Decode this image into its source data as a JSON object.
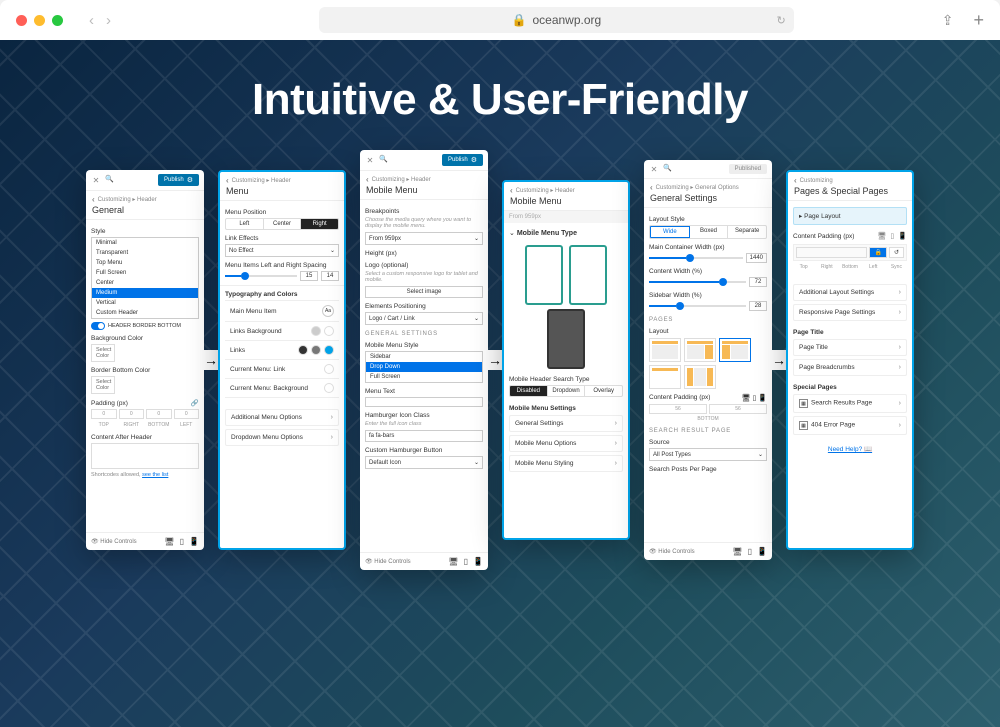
{
  "browser": {
    "url": "oceanwp.org"
  },
  "headline": "Intuitive & User-Friendly",
  "publish": "Publish",
  "published": "Published",
  "panel1": {
    "crumb": "Customizing ▸ Header",
    "title": "General",
    "style_label": "Style",
    "style_options": [
      "Minimal",
      "Transparent",
      "Top Menu",
      "Full Screen",
      "Center",
      "Medium",
      "Vertical",
      "Custom Header"
    ],
    "header_border_label": "HEADER BORDER BOTTOM",
    "bg_color_label": "Background Color",
    "select_color": "Select Color",
    "border_bottom_label": "Border Bottom Color",
    "padding_label": "Padding (px)",
    "padding_sides": [
      "TOP",
      "RIGHT",
      "BOTTOM",
      "LEFT"
    ],
    "padding_vals": [
      "0",
      "0",
      "0",
      "0"
    ],
    "content_after": "Content After Header",
    "shortcodes": "Shortcodes allowed,",
    "shortcodes_link": "see the list",
    "hide_controls": "Hide Controls"
  },
  "panel2": {
    "crumb": "Customizing ▸ Header",
    "title": "Menu",
    "menu_position": "Menu Position",
    "pos_opts": [
      "Left",
      "Center",
      "Right"
    ],
    "link_effects": "Link Effects",
    "no_effect": "No Effect",
    "spacing_label": "Menu Items Left and Right Spacing",
    "spacing_vals": [
      "15",
      "14"
    ],
    "typo_section": "Typography and Colors",
    "main_item": "Main Menu Item",
    "links_bg": "Links Background",
    "links": "Links",
    "current_link": "Current Menu: Link",
    "current_bg": "Current Menu: Background",
    "addl_menu": "Additional Menu Options",
    "dropdown_menu": "Dropdown Menu Options"
  },
  "panel3": {
    "crumb": "Customizing ▸ Header",
    "title": "Mobile Menu",
    "breakpoints_label": "Breakpoints",
    "breakpoints_hint": "Choose the media query where you want to display the mobile menu.",
    "breakpoint_val": "From 959px",
    "height_label": "Height (px)",
    "logo_label": "Logo (optional)",
    "logo_hint": "Select a custom responsive logo for tablet and mobile.",
    "select_image": "Select image",
    "elements_pos": "Elements Positioning",
    "elements_val": "Logo / Cart / Link",
    "general_section": "GENERAL SETTINGS",
    "mobile_style": "Mobile Menu Style",
    "style_opts": [
      "Sidebar",
      "Drop Down",
      "Full Screen"
    ],
    "menu_text": "Menu Text",
    "hamburger_label": "Hamburger Icon Class",
    "hamburger_hint": "Enter the full icon class",
    "hamburger_val": "fa fa-bars",
    "custom_btn": "Custom Hamburger Button",
    "custom_btn_val": "Default Icon",
    "hide_controls": "Hide Controls"
  },
  "panel4": {
    "crumb": "Customizing ▸ Header",
    "title": "Mobile Menu",
    "dd_label": "Mobile Menu Type",
    "search_type": "Mobile Header Search Type",
    "search_opts": [
      "Disabled",
      "Dropdown",
      "Overlay"
    ],
    "settings_section": "Mobile Menu Settings",
    "rows": [
      "General Settings",
      "Mobile Menu Options",
      "Mobile Menu Styling"
    ]
  },
  "panel5": {
    "crumb": "Customizing ▸ General Options",
    "title": "General Settings",
    "layout_style": "Layout Style",
    "layout_opts": [
      "Wide",
      "Boxed",
      "Separate"
    ],
    "main_width": "Main Container Width (px)",
    "main_width_val": "1440",
    "content_width": "Content Width (%)",
    "content_width_val": "72",
    "sidebar_width": "Sidebar Width (%)",
    "sidebar_width_val": "28",
    "pages_section": "PAGES",
    "layout_label": "Layout",
    "content_padding": "Content Padding (px)",
    "cp_vals": [
      "56",
      "56"
    ],
    "bottom_label": "BOTTOM",
    "search_section": "SEARCH RESULT PAGE",
    "source_label": "Source",
    "source_val": "All Post Types",
    "posts_per_page": "Search Posts Per Page",
    "hide_controls": "Hide Controls"
  },
  "panel6": {
    "crumb": "Customizing",
    "title": "Pages & Special Pages",
    "page_layout": "Page Layout",
    "content_padding": "Content Padding (px)",
    "pad_sides": [
      "Top",
      "Right",
      "Bottom",
      "Left",
      "Sync"
    ],
    "rows1": [
      "Additional Layout Settings",
      "Responsive Page Settings"
    ],
    "page_title_section": "Page Title",
    "rows2": [
      "Page Title",
      "Page Breadcrumbs"
    ],
    "special_section": "Special Pages",
    "rows3": [
      "Search Results Page",
      "404 Error Page"
    ],
    "need_help": "Need Help?"
  }
}
